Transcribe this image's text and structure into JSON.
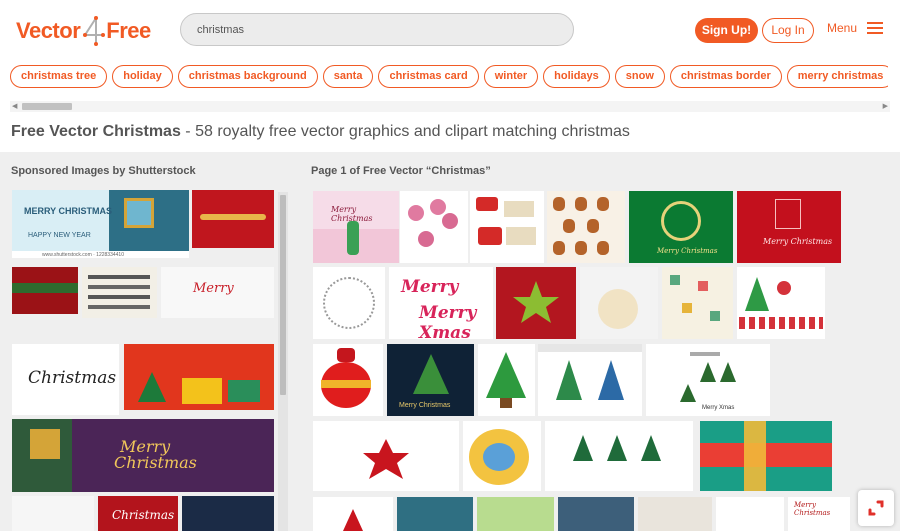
{
  "brand": {
    "name_left": "Vector",
    "name_right": "Free",
    "accent": "#f15a24"
  },
  "search": {
    "value": "christmas",
    "placeholder": ""
  },
  "nav": {
    "signup": "Sign Up!",
    "login": "Log In",
    "menu": "Menu"
  },
  "tags": [
    "christmas tree",
    "holiday",
    "christmas background",
    "santa",
    "christmas card",
    "winter",
    "holidays",
    "snow",
    "christmas border",
    "merry christmas"
  ],
  "heading": {
    "bold": "Free Vector Christmas",
    "rest": " - 58 royalty free vector graphics and clipart matching christmas"
  },
  "sponsored": {
    "title": "Sponsored Images by Shutterstock"
  },
  "results": {
    "title": "Page 1 of Free Vector “Christmas”"
  },
  "image_texts": {
    "merry_christmas_banner": "MERRY CHRISTMAS",
    "happy_new_year": "HAPPY NEW YEAR",
    "shutterstock_url": "www.shutterstock.com · 1228334410",
    "christmas_script": "Christmas",
    "merry_script": "Merry",
    "merry_christmas_small": "Merry Christmas",
    "merry_xmas": "Merry Xmas",
    "merry_christmas_card": "Merry Christmas",
    "merry_xmas_small": "Merry Xmas"
  }
}
